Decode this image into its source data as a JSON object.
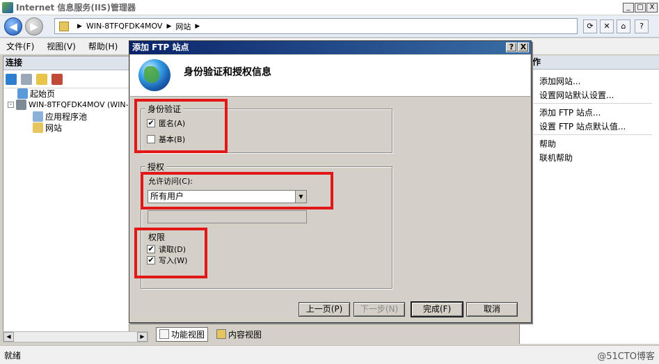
{
  "window": {
    "title": "Internet 信息服务(IIS)管理器",
    "min": "_",
    "max": "□",
    "close": "X"
  },
  "addressbar": {
    "crumbs": [
      "WIN-8TFQFDK4MOV",
      "网站"
    ],
    "separator": "▶"
  },
  "menu": {
    "items": [
      "文件(F)",
      "视图(V)",
      "帮助(H)"
    ]
  },
  "connections": {
    "header": "连接",
    "tree": [
      {
        "label": "起始页"
      },
      {
        "label": "WIN-8TFQFDK4MOV (WIN-8T"
      },
      {
        "label": "应用程序池"
      },
      {
        "label": "网站"
      }
    ]
  },
  "actions": {
    "header": "作",
    "items": [
      "添加网站...",
      "设置网站默认设置...",
      "添加 FTP 站点...",
      "设置 FTP 站点默认值...",
      "帮助",
      "联机帮助"
    ]
  },
  "view_tabs": {
    "features": "功能视图",
    "content": "内容视图"
  },
  "status": {
    "text": "就绪",
    "watermark": "@51CTO博客"
  },
  "dialog": {
    "title": "添加 FTP 站点",
    "help": "?",
    "close": "X",
    "heading": "身份验证和授权信息",
    "auth_group": {
      "legend": "身份验证",
      "anonymous": {
        "label": "匿名(A)",
        "checked": true
      },
      "basic": {
        "label": "基本(B)",
        "checked": false
      }
    },
    "authz_group": {
      "legend": "授权",
      "allow_label": "允许访问(C):",
      "allow_value": "所有用户",
      "perm_label": "权限",
      "read": {
        "label": "读取(D)",
        "checked": true
      },
      "write": {
        "label": "写入(W)",
        "checked": true
      }
    },
    "buttons": {
      "prev": "上一页(P)",
      "next": "下一步(N)",
      "finish": "完成(F)",
      "cancel": "取消"
    },
    "check_mark": "✔"
  },
  "colors": {
    "highlight": "#e21818",
    "titlebar": "#0a246a"
  }
}
